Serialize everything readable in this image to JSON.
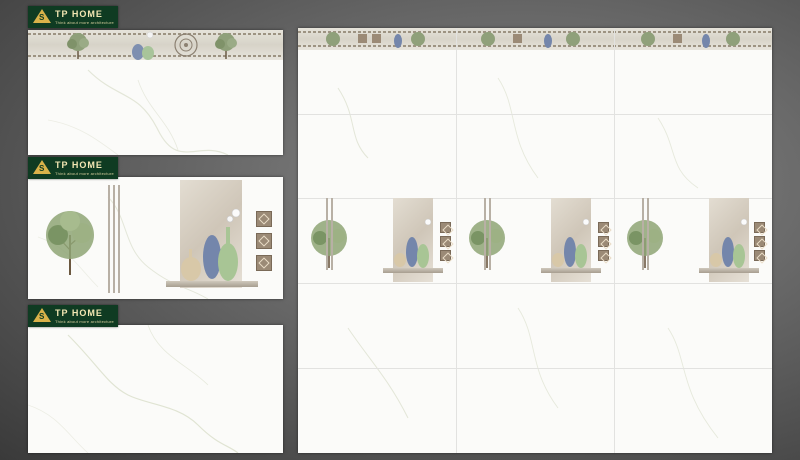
{
  "brand": {
    "name": "TP HOME",
    "tagline": "Think about more architecture",
    "badge_letter": "S",
    "colors": {
      "badge_bg": "#0f3b22",
      "badge_text": "#f3e7b3",
      "badge_accent": "#d9b24a"
    }
  },
  "samples": [
    {
      "kind": "border-tile",
      "label": "Border tile with vase and tree strip"
    },
    {
      "kind": "feature-tile",
      "label": "Feature tile with tree and vase panel"
    },
    {
      "kind": "plain-tile",
      "label": "Plain white marble tile"
    }
  ],
  "wall_layout": {
    "columns": 3,
    "rows": 5,
    "feature_row": 3
  }
}
